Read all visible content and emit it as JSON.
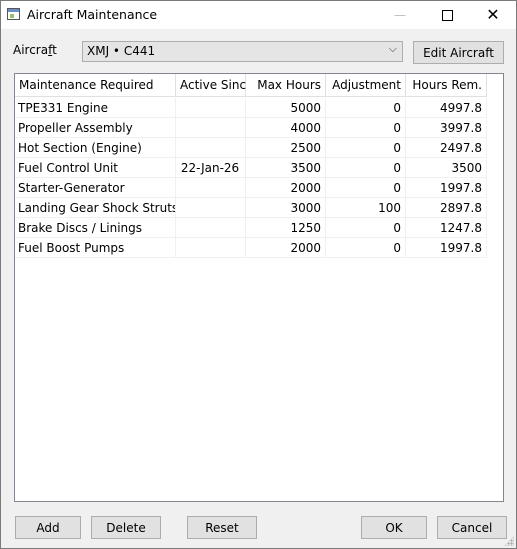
{
  "window": {
    "title": "Aircraft Maintenance",
    "minimize_glyph": "—",
    "close_glyph": "✕"
  },
  "aircraft": {
    "label_prefix": "Aircra",
    "label_accel": "f",
    "label_suffix": "t",
    "selected": "XMJ • C441",
    "dropdown_glyph": "⌵",
    "edit_label": "Edit Aircraft"
  },
  "grid": {
    "columns": [
      "Maintenance Required",
      "Active Since",
      "Max Hours",
      "Adjustment",
      "Hours Rem."
    ],
    "rows": [
      [
        "TPE331 Engine",
        "",
        "5000",
        "0",
        "4997.8"
      ],
      [
        "Propeller Assembly",
        "",
        "4000",
        "0",
        "3997.8"
      ],
      [
        "Hot Section (Engine)",
        "",
        "2500",
        "0",
        "2497.8"
      ],
      [
        "Fuel Control Unit",
        "22-Jan-26",
        "3500",
        "0",
        "3500"
      ],
      [
        "Starter-Generator",
        "",
        "2000",
        "0",
        "1997.8"
      ],
      [
        "Landing Gear Shock Struts",
        "",
        "3000",
        "100",
        "2897.8"
      ],
      [
        "Brake Discs / Linings",
        "",
        "1250",
        "0",
        "1247.8"
      ],
      [
        "Fuel Boost Pumps",
        "",
        "2000",
        "0",
        "1997.8"
      ]
    ]
  },
  "buttons": {
    "add": "Add",
    "delete": "Delete",
    "reset": "Reset",
    "ok": "OK",
    "cancel": "Cancel"
  },
  "icons": {
    "app": "app-window-icon",
    "minimize": "minimize-icon",
    "maximize": "maximize-icon",
    "close": "close-icon",
    "dropdown": "chevron-down-icon",
    "grip": "resize-grip-icon"
  }
}
